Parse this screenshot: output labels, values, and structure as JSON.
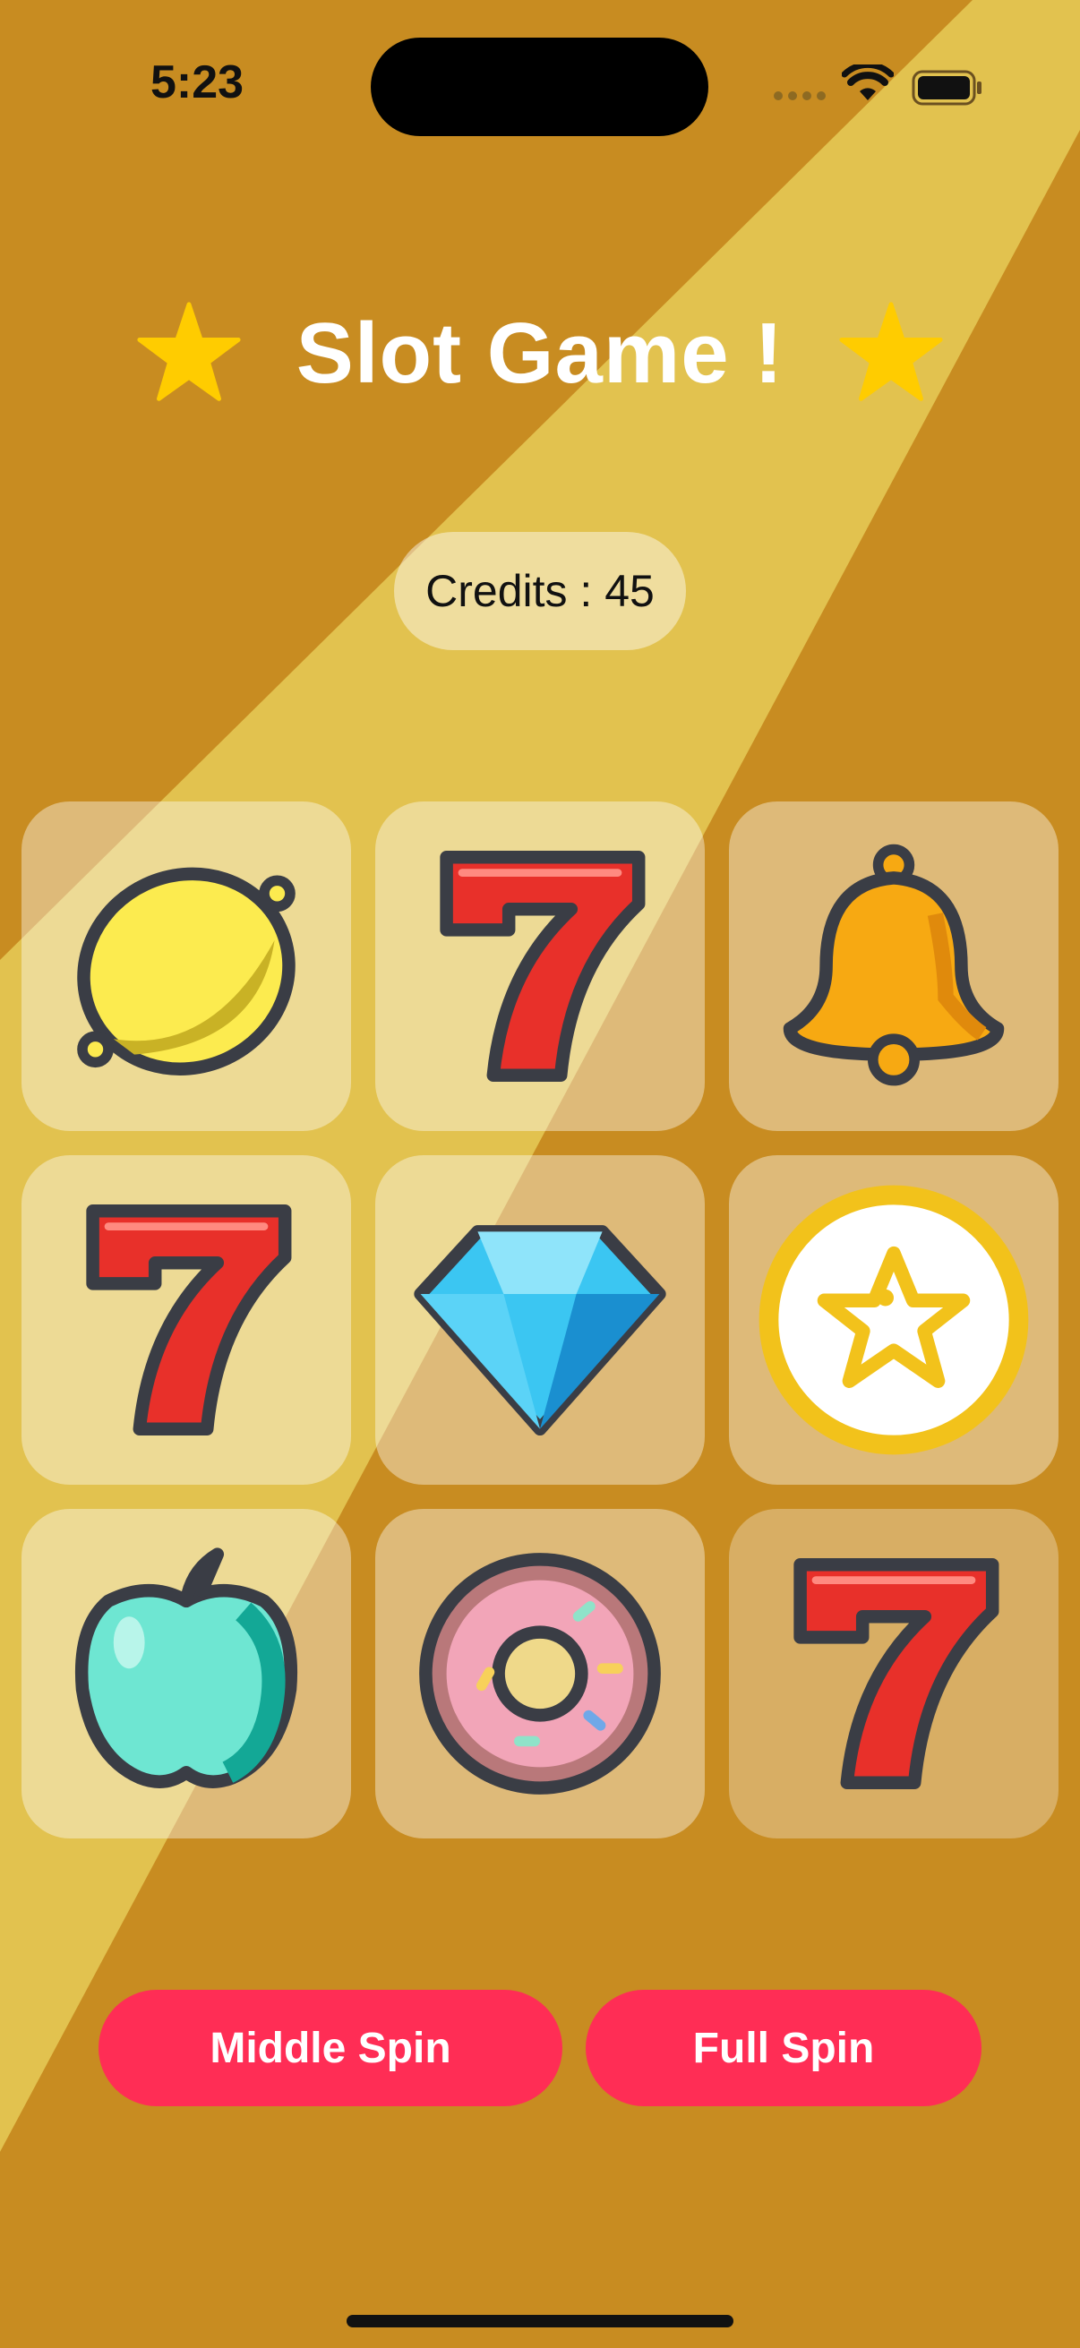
{
  "status_bar": {
    "time": "5:23"
  },
  "header": {
    "title": "Slot Game !",
    "left_icon": "star-icon",
    "right_icon": "star-icon"
  },
  "credits": {
    "text": "Credits : 45"
  },
  "grid": {
    "symbols": [
      [
        "lemon",
        "seven",
        "bell"
      ],
      [
        "seven",
        "diamond",
        "star-coin"
      ],
      [
        "apple",
        "donut",
        "seven"
      ]
    ]
  },
  "buttons": {
    "middle_spin": "Middle Spin",
    "full_spin": "Full Spin"
  },
  "colors": {
    "background": "#C88C21",
    "band": "#E2C24F",
    "button": "#FF2D55",
    "star": "#FFCC00"
  }
}
